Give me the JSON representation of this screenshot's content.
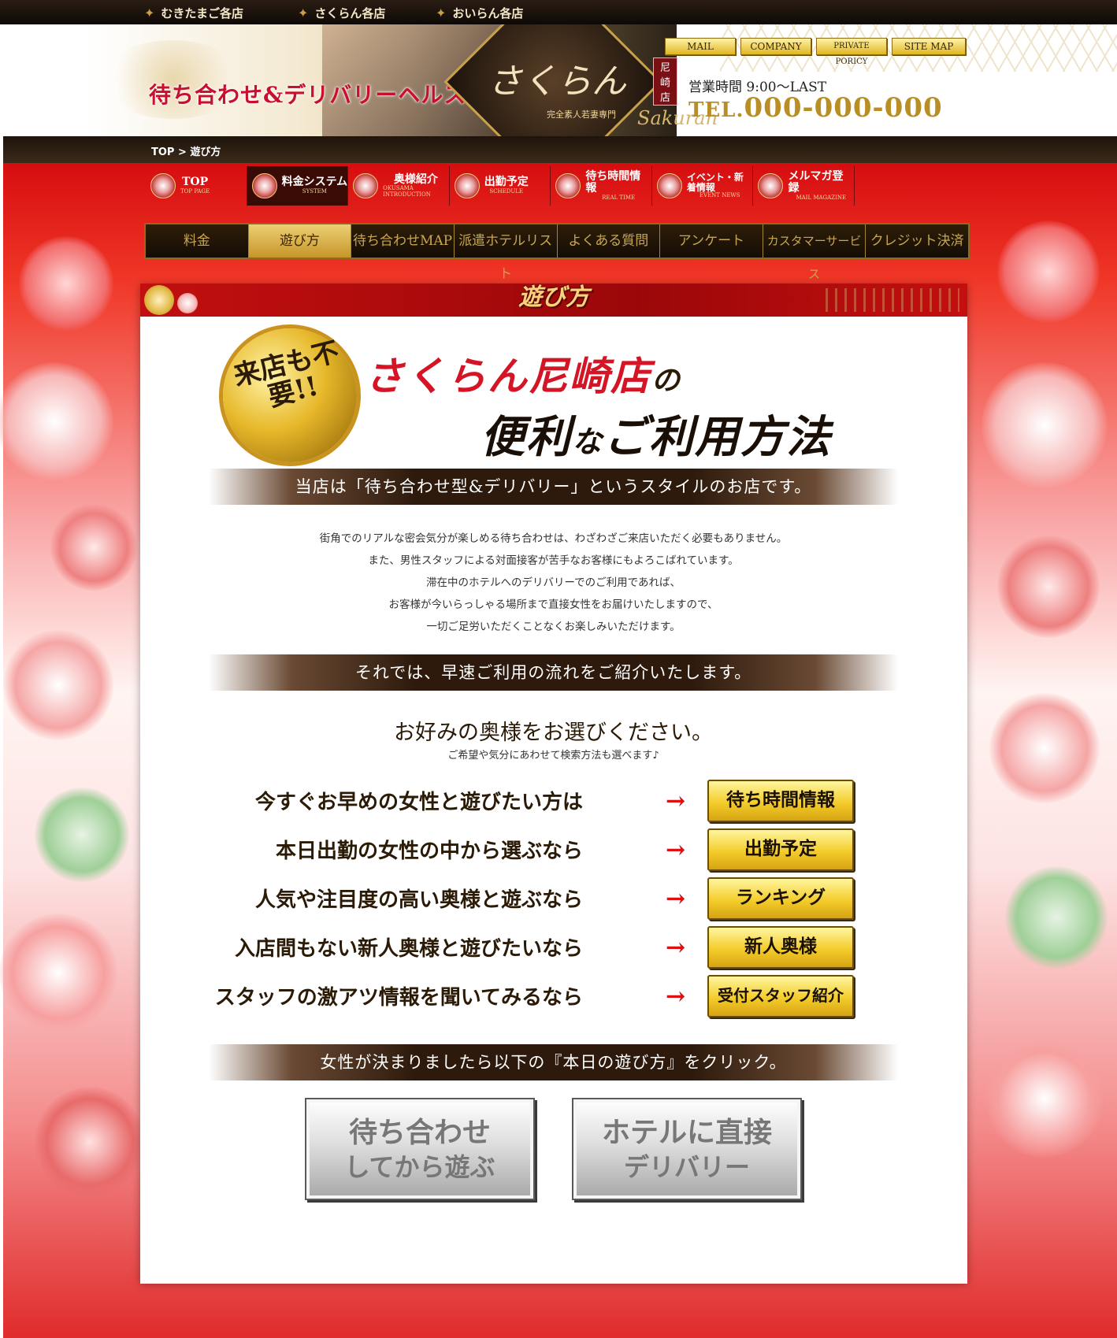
{
  "topbar": {
    "sites": [
      "むきたまご各店",
      "さくらん各店",
      "おいらん各店"
    ],
    "icon": "butterfly-icon"
  },
  "header": {
    "catch": "待ち合わせ&デリバリーヘルス",
    "brand": "さくらん",
    "branch": "尼崎店",
    "sub": "完全素人若妻専門",
    "romaji": "Sakuran",
    "nav": [
      "MAIL",
      "COMPANY",
      "PRIVATE PORICY",
      "SITE MAP"
    ],
    "hours": "営業時間 9:00～LAST",
    "tel_prefix": "TEL.",
    "tel": "000-000-000"
  },
  "breadcrumb": "TOP > 遊び方",
  "main_nav": [
    {
      "ja": "TOP",
      "en": "TOP PAGE"
    },
    {
      "ja": "料金システム",
      "en": "SYSTEM"
    },
    {
      "ja": "奥様紹介",
      "en": "OKUSAMA INTRODUCTION"
    },
    {
      "ja": "出勤予定",
      "en": "SCHEDULE"
    },
    {
      "ja": "待ち時間情報",
      "en": "REAL TIME"
    },
    {
      "ja": "イベント・新着情報",
      "en": "EVENT NEWS"
    },
    {
      "ja": "メルマガ登録",
      "en": "MAIL MAGAZINE"
    }
  ],
  "sub_nav": [
    "料金",
    "遊び方",
    "待ち合わせMAP",
    "派遣ホテルリスト",
    "よくある質問",
    "アンケート",
    "カスタマーサービス",
    "クレジット決済"
  ],
  "section": {
    "ribbon_title": "遊び方",
    "seal": "来店も不要!!",
    "title_line1": "さくらん尼崎店",
    "title_line1_suffix": "の",
    "title_line2_a": "便利",
    "title_line2_b": "な",
    "title_line2_c": "ご利用方法",
    "band1": "当店は「待ち合わせ型&デリバリー」というスタイルのお店です。",
    "desc": [
      "街角でのリアルな密会気分が楽しめる待ち合わせは、わざわざご来店いただく必要もありません。",
      "また、男性スタッフによる対面接客が苦手なお客様にもよろこばれています。",
      "滞在中のホテルへのデリバリーでのご利用であれば、",
      "お客様が今いらっしゃる場所まで直接女性をお届けいたしますので、",
      "一切ご足労いただくことなくお楽しみいただけます。"
    ],
    "band2": "それでは、早速ご利用の流れをご紹介いたします。",
    "choose": "お好みの奥様をお選びください。",
    "choose_sub": "ご希望や気分にあわせて検索方法も選べます♪",
    "rows": [
      {
        "label": "今すぐお早めの女性と遊びたい方は",
        "button": "待ち時間情報"
      },
      {
        "label": "本日出勤の女性の中から選ぶなら",
        "button": "出勤予定"
      },
      {
        "label": "人気や注目度の高い奥様と遊ぶなら",
        "button": "ランキング"
      },
      {
        "label": "入店間もない新人奥様と遊びたいなら",
        "button": "新人奥様"
      },
      {
        "label": "スタッフの激アツ情報を聞いてみるなら",
        "button": "受付スタッフ紹介"
      }
    ],
    "arrow": "→",
    "band3": "女性が決まりましたら以下の『本日の遊び方』をクリック。",
    "big_buttons": [
      {
        "line1": "待ち合わせ",
        "line2": "してから遊ぶ"
      },
      {
        "line1": "ホテルに直接",
        "line2": "デリバリー"
      }
    ]
  }
}
